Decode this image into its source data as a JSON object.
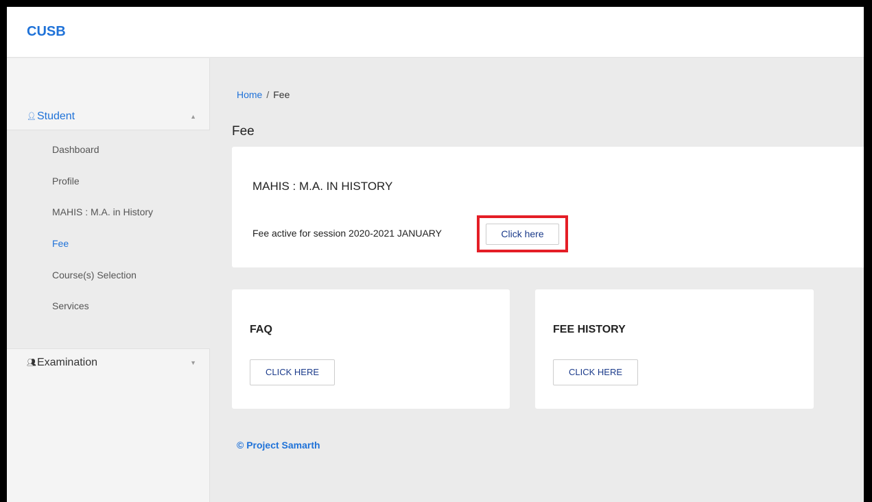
{
  "header": {
    "brand": "CUSB"
  },
  "sidebar": {
    "student_menu": {
      "icon": "person-icon",
      "label": "Student",
      "expanded": true
    },
    "items": [
      {
        "label": "Dashboard",
        "active": false
      },
      {
        "label": "Profile",
        "active": false
      },
      {
        "label": "MAHIS : M.A. in History",
        "active": false
      },
      {
        "label": "Fee",
        "active": true
      },
      {
        "label": "Course(s) Selection",
        "active": false
      },
      {
        "label": "Services",
        "active": false
      }
    ],
    "exam_menu": {
      "icon": "people-icon",
      "label": "Examination",
      "expanded": false
    }
  },
  "breadcrumb": {
    "home": "Home",
    "separator": "/",
    "current": "Fee"
  },
  "page_title": "Fee",
  "program_card": {
    "title": "MAHIS : M.A. IN HISTORY",
    "fee_text": "Fee active for session 2020-2021 JANUARY",
    "button_label": "Click here"
  },
  "faq_card": {
    "title": "FAQ",
    "button_label": "CLICK HERE"
  },
  "fee_history_card": {
    "title": "FEE HISTORY",
    "button_label": "CLICK HERE"
  },
  "footer": {
    "text": "© Project Samarth"
  },
  "colors": {
    "accent": "#1f72d8",
    "highlight": "#e41e26",
    "background": "#ebebeb"
  }
}
